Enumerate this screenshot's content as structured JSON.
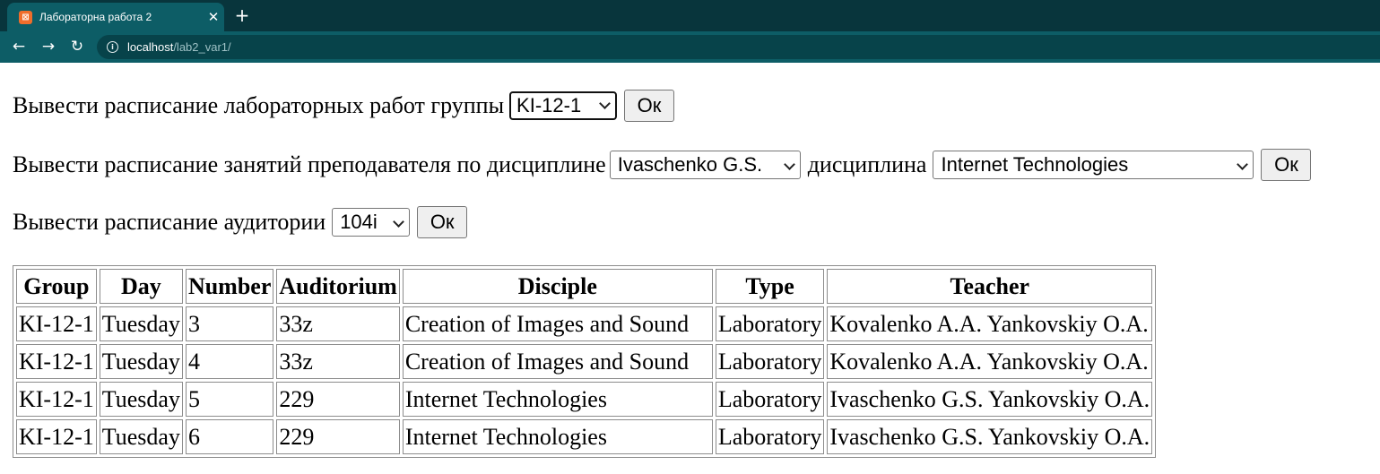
{
  "browser": {
    "tab_title": "Лабораторна работа 2",
    "url_host": "localhost",
    "url_path": "/lab2_var1/",
    "icons": {
      "favicon": "xampp-icon",
      "close": "close-icon",
      "new_tab": "plus-icon",
      "back": "back-arrow-icon",
      "forward": "forward-arrow-icon",
      "reload": "reload-icon",
      "site_info": "info-icon"
    }
  },
  "form": {
    "group": {
      "label": "Вывести расписание лабораторных работ группы",
      "selected": "KI-12-1",
      "button": "Ок"
    },
    "teacher": {
      "label": "Вывести расписание занятий преподавателя по дисциплине",
      "selected_teacher": "Ivaschenko G.S.",
      "discipline_label": "дисциплина",
      "selected_discipline": "Internet Technologies",
      "button": "Ок"
    },
    "auditorium": {
      "label": "Вывести расписание аудитории",
      "selected": "104i",
      "button": "Ок"
    }
  },
  "table": {
    "headers": [
      "Group",
      "Day",
      "Number",
      "Auditorium",
      "Disciple",
      "Type",
      "Teacher"
    ],
    "rows": [
      [
        "KI-12-1",
        "Tuesday",
        "3",
        "33z",
        "Creation of Images and Sound",
        "Laboratory",
        "Kovalenko A.A. Yankovskiy O.A."
      ],
      [
        "KI-12-1",
        "Tuesday",
        "4",
        "33z",
        "Creation of Images and Sound",
        "Laboratory",
        "Kovalenko A.A. Yankovskiy O.A."
      ],
      [
        "KI-12-1",
        "Tuesday",
        "5",
        "229",
        "Internet Technologies",
        "Laboratory",
        "Ivaschenko G.S. Yankovskiy O.A."
      ],
      [
        "KI-12-1",
        "Tuesday",
        "6",
        "229",
        "Internet Technologies",
        "Laboratory",
        "Ivaschenko G.S. Yankovskiy O.A."
      ]
    ]
  },
  "colors": {
    "tabstrip": "#08353c",
    "toolbar": "#0d5d66",
    "omnibox": "#07434a",
    "favicon": "#ef6d2b"
  }
}
